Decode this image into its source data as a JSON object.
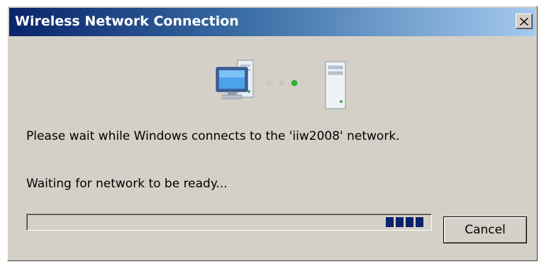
{
  "window": {
    "title": "Wireless Network Connection",
    "close_icon": "close-icon"
  },
  "illustration": {
    "computer_icon": "computer-icon",
    "connection_dots_icon": "connection-dots-icon",
    "server_icon": "server-icon"
  },
  "messages": {
    "connecting": "Please wait while Windows connects to the 'iiw2008' network.",
    "status": "Waiting for network to be ready..."
  },
  "progress": {
    "style": "marquee",
    "block_count": 4
  },
  "buttons": {
    "cancel_label": "Cancel"
  },
  "colors": {
    "title_gradient_start": "#0a246a",
    "title_gradient_end": "#a6caf0",
    "dialog_background": "#d4d0c8",
    "progress_block": "#0a246a",
    "active_dot": "#2fb52f"
  }
}
